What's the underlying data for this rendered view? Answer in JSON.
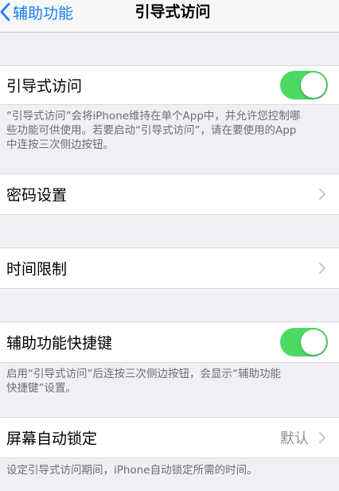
{
  "nav": {
    "back_label": "辅助功能",
    "title": "引导式访问"
  },
  "guided_access": {
    "label": "引导式访问",
    "toggle_on": true,
    "footer_line1": "“引导式访问”会将iPhone维持在单个App中，并允许您控制哪",
    "footer_line2": "些功能可供使用。若要启动“引导式访问”，请在要使用的App",
    "footer_line3": "中连按三次侧边按钮。"
  },
  "passcode_settings": {
    "label": "密码设置"
  },
  "time_limits": {
    "label": "时间限制"
  },
  "accessibility_shortcut": {
    "label": "辅助功能快捷键",
    "toggle_on": true,
    "footer_line1": "启用“引导式访问”后连按三次侧边按钮，会显示“辅助功能",
    "footer_line2": "快捷键”设置。"
  },
  "auto_lock": {
    "label": "屏幕自动锁定",
    "value": "默认",
    "footer": "设定引导式访问期间，iPhone自动锁定所需的时间。"
  },
  "colors": {
    "accent": "#147efb",
    "toggle_on": "#4cd964",
    "background": "#efeff4"
  }
}
